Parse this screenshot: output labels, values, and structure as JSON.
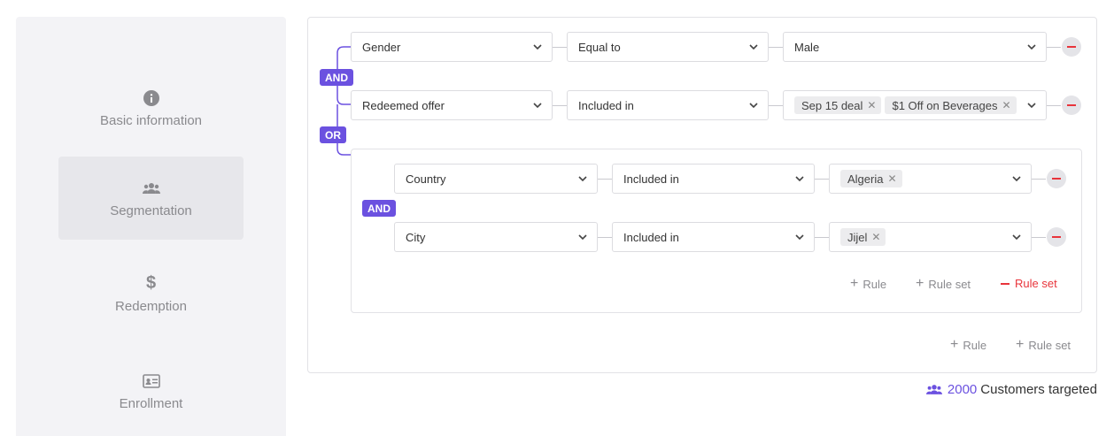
{
  "sidebar": {
    "steps": [
      {
        "label": "Basic information",
        "icon": "info-icon"
      },
      {
        "label": "Segmentation",
        "icon": "users-icon"
      },
      {
        "label": "Redemption",
        "icon": "dollar-icon"
      },
      {
        "label": "Enrollment",
        "icon": "id-card-icon"
      }
    ]
  },
  "rules": [
    {
      "field": "Gender",
      "operator": "Equal to",
      "value": "Male"
    },
    {
      "field": "Redeemed offer",
      "operator": "Included in",
      "chips": [
        "Sep 15 deal",
        "$1 Off on Beverages"
      ]
    }
  ],
  "operators": {
    "top": "AND",
    "outer": "OR",
    "nested": "AND"
  },
  "nested_rules": [
    {
      "field": "Country",
      "operator": "Included in",
      "chips": [
        "Algeria"
      ]
    },
    {
      "field": "City",
      "operator": "Included in",
      "chips": [
        "Jijel"
      ]
    }
  ],
  "nested_actions": {
    "add_rule": "Rule",
    "add_rule_set": "Rule set",
    "remove_rule_set": "Rule set"
  },
  "outer_actions": {
    "add_rule": "Rule",
    "add_rule_set": "Rule set"
  },
  "footer": {
    "count": "2000",
    "label": "Customers targeted"
  },
  "colors": {
    "accent": "#6b51e0",
    "danger": "#e8343b"
  }
}
